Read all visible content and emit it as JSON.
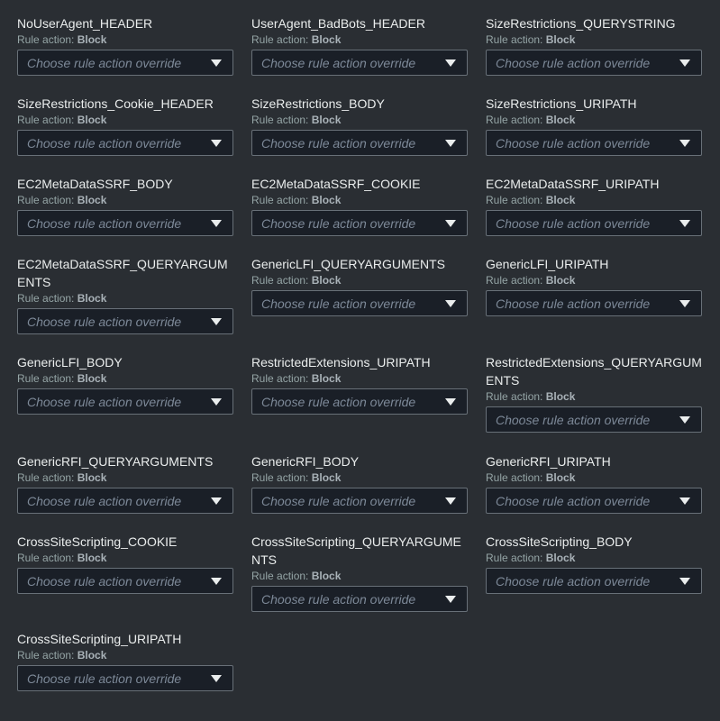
{
  "rule_action_label": "Rule action:",
  "select_placeholder": "Choose rule action override",
  "rules": [
    {
      "name": "NoUserAgent_HEADER",
      "action": "Block"
    },
    {
      "name": "UserAgent_BadBots_HEADER",
      "action": "Block"
    },
    {
      "name": "SizeRestrictions_QUERYSTRING",
      "action": "Block"
    },
    {
      "name": "SizeRestrictions_Cookie_HEADER",
      "action": "Block"
    },
    {
      "name": "SizeRestrictions_BODY",
      "action": "Block"
    },
    {
      "name": "SizeRestrictions_URIPATH",
      "action": "Block"
    },
    {
      "name": "EC2MetaDataSSRF_BODY",
      "action": "Block"
    },
    {
      "name": "EC2MetaDataSSRF_COOKIE",
      "action": "Block"
    },
    {
      "name": "EC2MetaDataSSRF_URIPATH",
      "action": "Block"
    },
    {
      "name": "EC2MetaDataSSRF_QUERYARGUMENTS",
      "action": "Block"
    },
    {
      "name": "GenericLFI_QUERYARGUMENTS",
      "action": "Block"
    },
    {
      "name": "GenericLFI_URIPATH",
      "action": "Block"
    },
    {
      "name": "GenericLFI_BODY",
      "action": "Block"
    },
    {
      "name": "RestrictedExtensions_URIPATH",
      "action": "Block"
    },
    {
      "name": "RestrictedExtensions_QUERYARGUMENTS",
      "action": "Block"
    },
    {
      "name": "GenericRFI_QUERYARGUMENTS",
      "action": "Block"
    },
    {
      "name": "GenericRFI_BODY",
      "action": "Block"
    },
    {
      "name": "GenericRFI_URIPATH",
      "action": "Block"
    },
    {
      "name": "CrossSiteScripting_COOKIE",
      "action": "Block"
    },
    {
      "name": "CrossSiteScripting_QUERYARGUMENTS",
      "action": "Block"
    },
    {
      "name": "CrossSiteScripting_BODY",
      "action": "Block"
    },
    {
      "name": "CrossSiteScripting_URIPATH",
      "action": "Block"
    }
  ]
}
